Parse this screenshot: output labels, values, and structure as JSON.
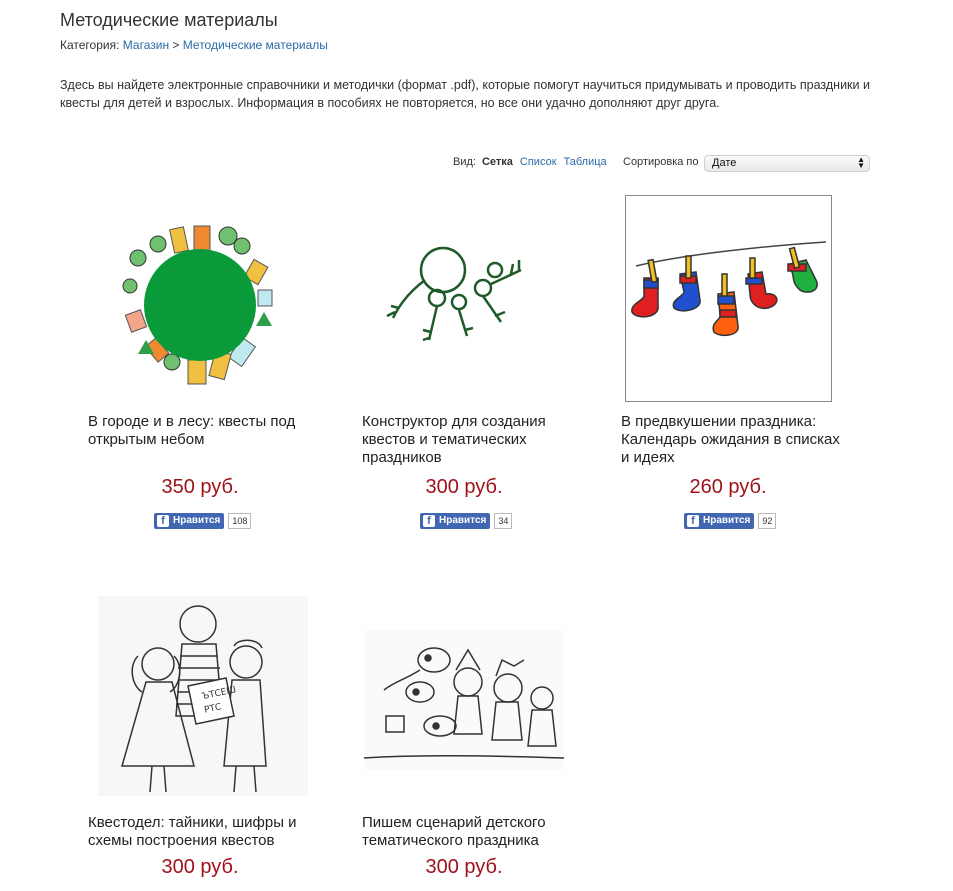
{
  "page": {
    "title": "Методические материалы",
    "breadcrumb": {
      "prefix": "Категория:",
      "shop": "Магазин",
      "separator": ">",
      "current": "Методические материалы"
    },
    "intro": "Здесь вы найдете электронные справочники и методички (формат .pdf), которые помогут научиться придумывать и проводить праздники и квесты для детей и взрослых. Информация в пособиях не повторяется, но все они удачно дополняют друг друга."
  },
  "view": {
    "label": "Вид:",
    "grid": "Сетка",
    "list": "Список",
    "table": "Таблица"
  },
  "sort": {
    "label": "Сортировка по",
    "selected": "Дате"
  },
  "facebook": {
    "like_label": "Нравится",
    "icon": "facebook-f-icon"
  },
  "products": [
    {
      "title": "В городе и в лесу: квесты под открытым небом",
      "price": "350 руб.",
      "likes": "108"
    },
    {
      "title": "Конструктор для создания квестов и тематических праздников",
      "price": "300 руб.",
      "likes": "34"
    },
    {
      "title": "В предвкушении праздника: Календарь ожидания в списках и идеях",
      "price": "260 руб.",
      "likes": "92"
    },
    {
      "title": "Квестодел: тайники, шифры и схемы построения квестов",
      "price": "300 руб."
    },
    {
      "title": "Пишем сценарий детского тематического праздника",
      "price": "300 руб."
    }
  ],
  "colors": {
    "link": "#2a6aa8",
    "price": "#a0121b",
    "facebook": "#4267b2"
  }
}
